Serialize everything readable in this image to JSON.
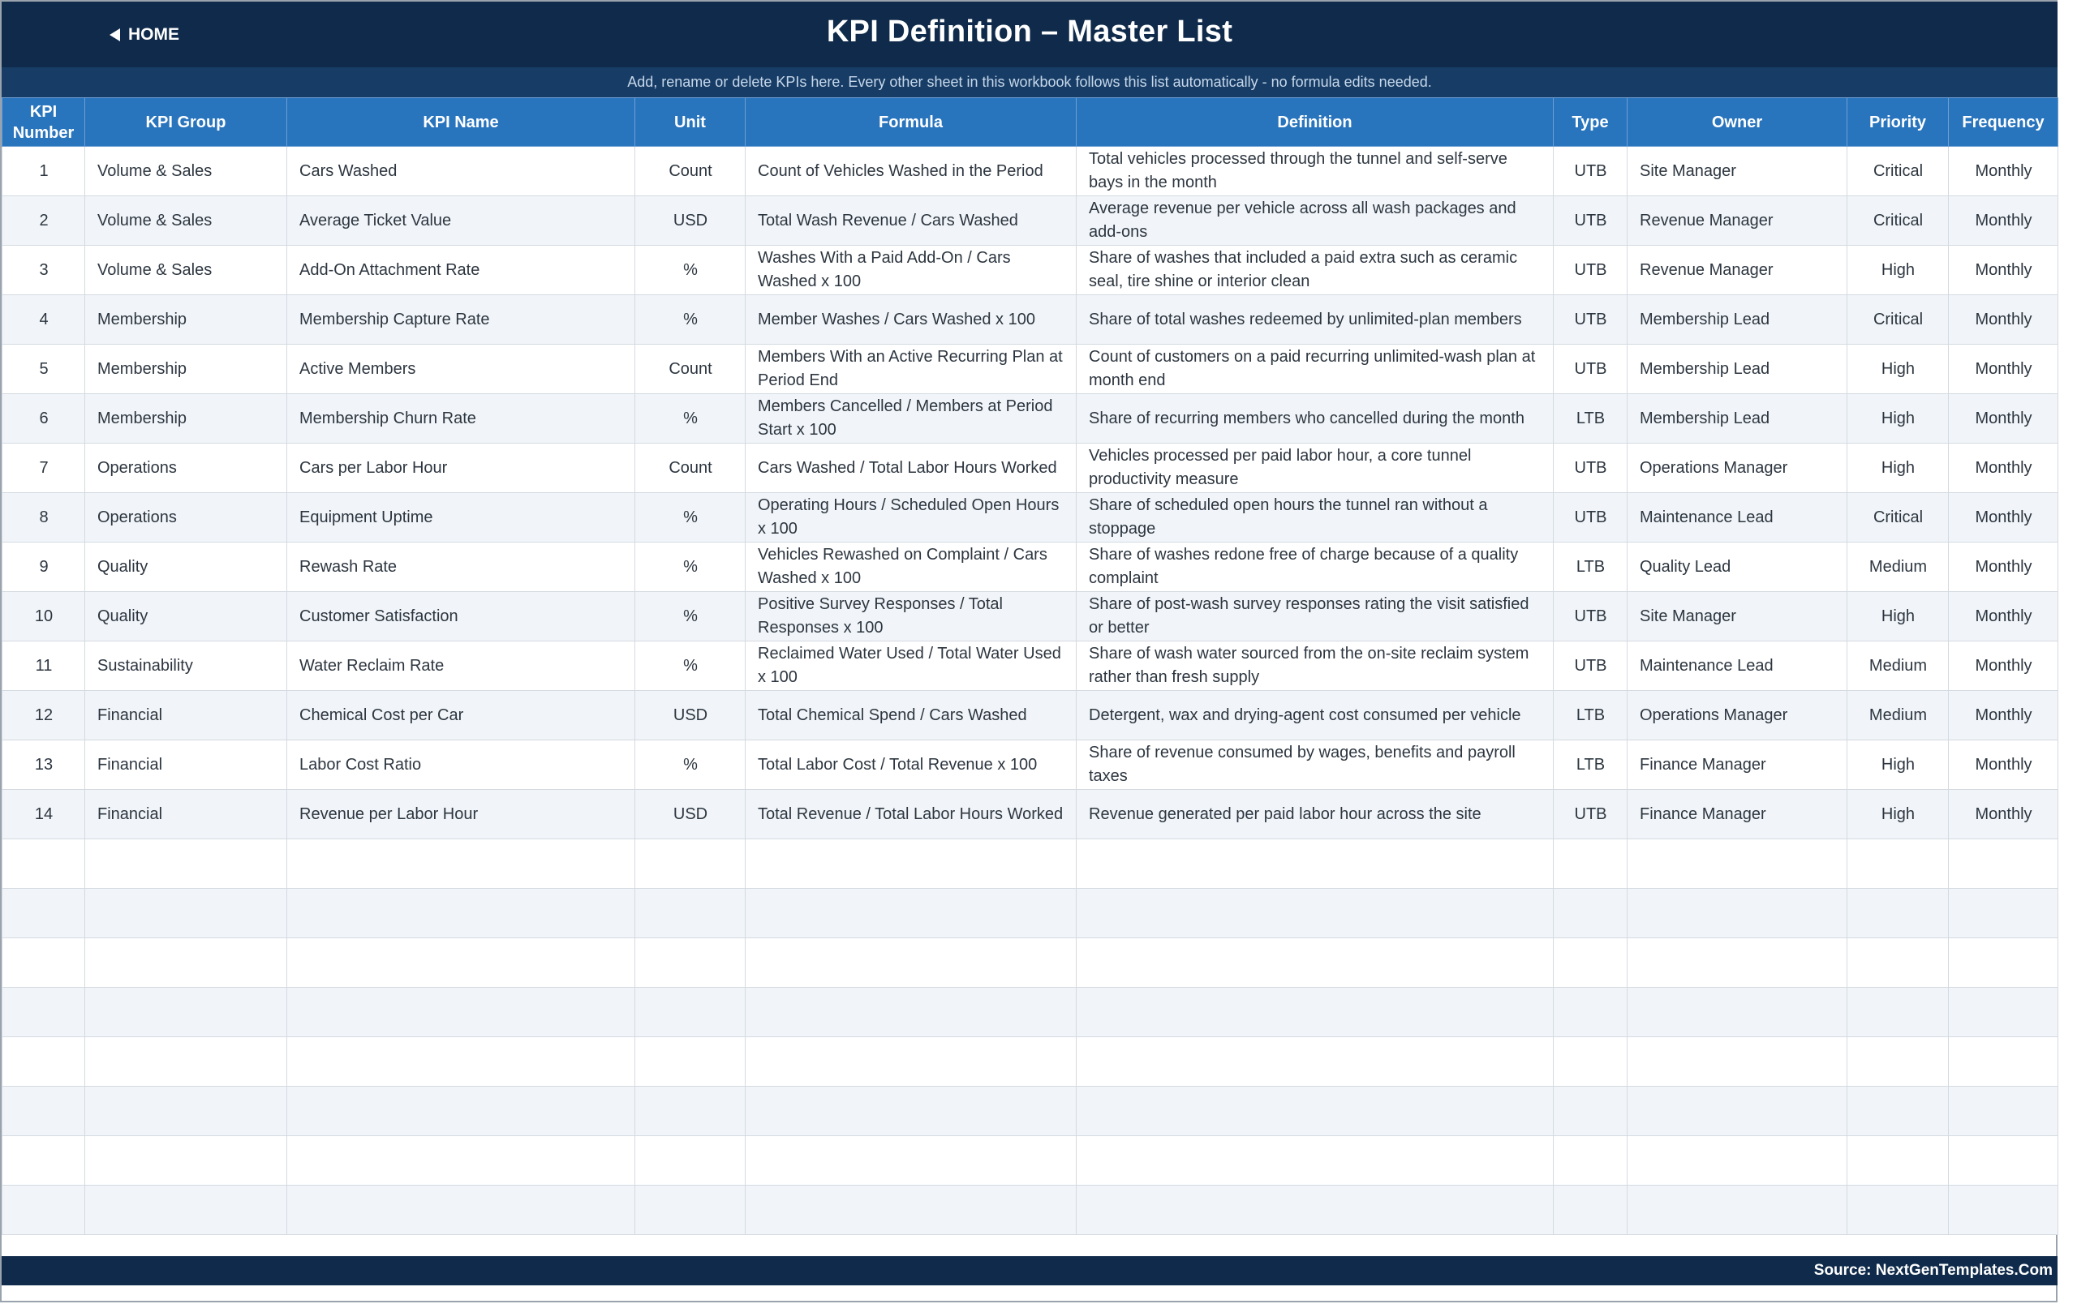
{
  "header": {
    "home_label": "HOME",
    "title": "KPI Definition  –  Master List",
    "subtitle": "Add, rename or delete KPIs here. Every other sheet in this workbook follows this list automatically - no formula edits needed."
  },
  "table": {
    "columns": {
      "number": "KPI Number",
      "group": "KPI Group",
      "name": "KPI Name",
      "unit": "Unit",
      "formula": "Formula",
      "definition": "Definition",
      "type": "Type",
      "owner": "Owner",
      "priority": "Priority",
      "frequency": "Frequency"
    },
    "rows": [
      {
        "number": "1",
        "group": "Volume & Sales",
        "name": "Cars Washed",
        "unit": "Count",
        "formula": "Count of Vehicles Washed in the Period",
        "definition": "Total vehicles processed through the tunnel and self-serve bays in the month",
        "type": "UTB",
        "owner": "Site Manager",
        "priority": "Critical",
        "frequency": "Monthly"
      },
      {
        "number": "2",
        "group": "Volume & Sales",
        "name": "Average Ticket Value",
        "unit": "USD",
        "formula": "Total Wash Revenue / Cars Washed",
        "definition": "Average revenue per vehicle across all wash packages and add-ons",
        "type": "UTB",
        "owner": "Revenue Manager",
        "priority": "Critical",
        "frequency": "Monthly"
      },
      {
        "number": "3",
        "group": "Volume & Sales",
        "name": "Add-On Attachment Rate",
        "unit": "%",
        "formula": "Washes With a Paid Add-On / Cars Washed x 100",
        "definition": "Share of washes that included a paid extra such as ceramic seal, tire shine or interior clean",
        "type": "UTB",
        "owner": "Revenue Manager",
        "priority": "High",
        "frequency": "Monthly"
      },
      {
        "number": "4",
        "group": "Membership",
        "name": "Membership Capture Rate",
        "unit": "%",
        "formula": "Member Washes / Cars Washed x 100",
        "definition": "Share of total washes redeemed by unlimited-plan members",
        "type": "UTB",
        "owner": "Membership Lead",
        "priority": "Critical",
        "frequency": "Monthly"
      },
      {
        "number": "5",
        "group": "Membership",
        "name": "Active Members",
        "unit": "Count",
        "formula": "Members With an Active Recurring Plan at Period End",
        "definition": "Count of customers on a paid recurring unlimited-wash plan at month end",
        "type": "UTB",
        "owner": "Membership Lead",
        "priority": "High",
        "frequency": "Monthly"
      },
      {
        "number": "6",
        "group": "Membership",
        "name": "Membership Churn Rate",
        "unit": "%",
        "formula": "Members Cancelled / Members at Period Start x 100",
        "definition": "Share of recurring members who cancelled during the month",
        "type": "LTB",
        "owner": "Membership Lead",
        "priority": "High",
        "frequency": "Monthly"
      },
      {
        "number": "7",
        "group": "Operations",
        "name": "Cars per Labor Hour",
        "unit": "Count",
        "formula": "Cars Washed / Total Labor Hours Worked",
        "definition": "Vehicles processed per paid labor hour, a core tunnel productivity measure",
        "type": "UTB",
        "owner": "Operations Manager",
        "priority": "High",
        "frequency": "Monthly"
      },
      {
        "number": "8",
        "group": "Operations",
        "name": "Equipment Uptime",
        "unit": "%",
        "formula": "Operating Hours / Scheduled Open Hours x 100",
        "definition": "Share of scheduled open hours the tunnel ran without a stoppage",
        "type": "UTB",
        "owner": "Maintenance Lead",
        "priority": "Critical",
        "frequency": "Monthly"
      },
      {
        "number": "9",
        "group": "Quality",
        "name": "Rewash Rate",
        "unit": "%",
        "formula": "Vehicles Rewashed on Complaint / Cars Washed x 100",
        "definition": "Share of washes redone free of charge because of a quality complaint",
        "type": "LTB",
        "owner": "Quality Lead",
        "priority": "Medium",
        "frequency": "Monthly"
      },
      {
        "number": "10",
        "group": "Quality",
        "name": "Customer Satisfaction",
        "unit": "%",
        "formula": "Positive Survey Responses / Total Responses x 100",
        "definition": "Share of post-wash survey responses rating the visit satisfied or better",
        "type": "UTB",
        "owner": "Site Manager",
        "priority": "High",
        "frequency": "Monthly"
      },
      {
        "number": "11",
        "group": "Sustainability",
        "name": "Water Reclaim Rate",
        "unit": "%",
        "formula": "Reclaimed Water Used / Total Water Used x 100",
        "definition": "Share of wash water sourced from the on-site reclaim system rather than fresh supply",
        "type": "UTB",
        "owner": "Maintenance Lead",
        "priority": "Medium",
        "frequency": "Monthly"
      },
      {
        "number": "12",
        "group": "Financial",
        "name": "Chemical Cost per Car",
        "unit": "USD",
        "formula": "Total Chemical Spend / Cars Washed",
        "definition": "Detergent, wax and drying-agent cost consumed per vehicle",
        "type": "LTB",
        "owner": "Operations Manager",
        "priority": "Medium",
        "frequency": "Monthly"
      },
      {
        "number": "13",
        "group": "Financial",
        "name": "Labor Cost Ratio",
        "unit": "%",
        "formula": "Total Labor Cost / Total Revenue x 100",
        "definition": "Share of revenue consumed by wages, benefits and payroll taxes",
        "type": "LTB",
        "owner": "Finance Manager",
        "priority": "High",
        "frequency": "Monthly"
      },
      {
        "number": "14",
        "group": "Financial",
        "name": "Revenue per Labor Hour",
        "unit": "USD",
        "formula": "Total Revenue / Total Labor Hours Worked",
        "definition": "Revenue generated per paid labor hour across the site",
        "type": "UTB",
        "owner": "Finance Manager",
        "priority": "High",
        "frequency": "Monthly"
      }
    ]
  },
  "footer": {
    "source": "Source: NextGenTemplates.Com"
  }
}
